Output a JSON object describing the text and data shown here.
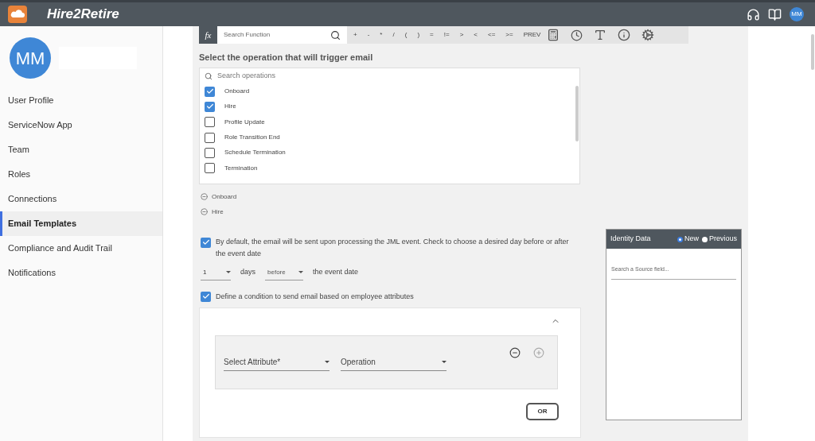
{
  "app": {
    "title": "Hire2Retire",
    "avatar": "MM"
  },
  "profile": {
    "initials": "MM"
  },
  "sidebar": {
    "items": [
      {
        "label": "User Profile",
        "selected": false
      },
      {
        "label": "ServiceNow App",
        "selected": false
      },
      {
        "label": "Team",
        "selected": false
      },
      {
        "label": "Roles",
        "selected": false
      },
      {
        "label": "Connections",
        "selected": false
      },
      {
        "label": "Email Templates",
        "selected": true
      },
      {
        "label": "Compliance and Audit Trail",
        "selected": false
      },
      {
        "label": "Notifications",
        "selected": false
      }
    ]
  },
  "toolbar": {
    "fx": "fx",
    "placeholder": "Search Function",
    "operators": [
      "+",
      "-",
      "*",
      "/",
      "(",
      ")",
      "=",
      "!=",
      ">",
      "<",
      "<=",
      ">=",
      "PREV"
    ]
  },
  "trigger": {
    "heading": "Select the operation that will trigger email",
    "search_placeholder": "Search operations",
    "options": [
      {
        "label": "Onboard",
        "checked": true
      },
      {
        "label": "Hire",
        "checked": true
      },
      {
        "label": "Profile Update",
        "checked": false
      },
      {
        "label": "Role Transition End",
        "checked": false
      },
      {
        "label": "Schedule Termination",
        "checked": false
      },
      {
        "label": "Termination",
        "checked": false
      }
    ],
    "chips": [
      "Onboard",
      "Hire"
    ]
  },
  "schedule": {
    "checked": true,
    "text": "By default, the email will be sent upon processing the JML event. Check to choose a desired day before or after the event date",
    "days_value": "1",
    "days_label": "days",
    "direction": "before",
    "suffix": "the event date"
  },
  "condition": {
    "checked": true,
    "label": "Define a condition to send email based on employee attributes",
    "attribute_placeholder": "Select Attribute*",
    "operation_placeholder": "Operation",
    "or_button": "OR"
  },
  "identity": {
    "title": "Identity Data",
    "options": [
      {
        "label": "New",
        "selected": true
      },
      {
        "label": "Previous",
        "selected": false
      }
    ],
    "search_placeholder": "Search a Source field..."
  }
}
